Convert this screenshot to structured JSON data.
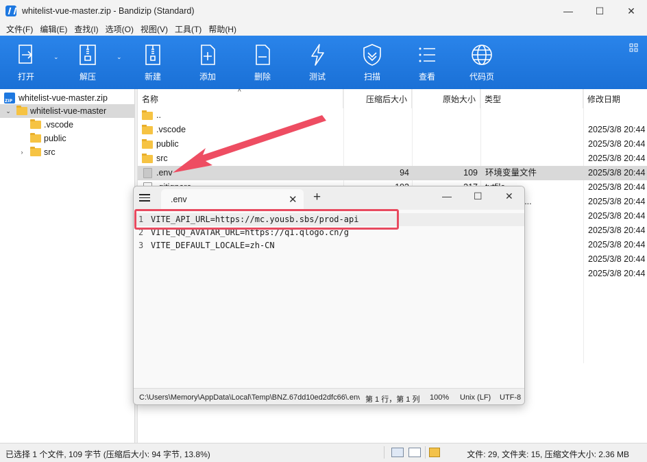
{
  "window": {
    "title": "whitelist-vue-master.zip - Bandizip (Standard)"
  },
  "menu": [
    "文件(F)",
    "编辑(E)",
    "查找(I)",
    "选项(O)",
    "视图(V)",
    "工具(T)",
    "帮助(H)"
  ],
  "toolbar": {
    "open": "打开",
    "extract": "解压",
    "new": "新建",
    "add": "添加",
    "delete": "删除",
    "test": "测试",
    "scan": "扫描",
    "view": "查看",
    "codepage": "代码页"
  },
  "tree": {
    "root": "whitelist-vue-master.zip",
    "folder": "whitelist-vue-master",
    "children": [
      ".vscode",
      "public",
      "src"
    ]
  },
  "columns": {
    "name": "名称",
    "compressed": "压缩后大小",
    "original": "原始大小",
    "type": "类型",
    "modified": "修改日期"
  },
  "rows": [
    {
      "name": "..",
      "compressed": "",
      "original": "",
      "type": "",
      "modified": ""
    },
    {
      "name": ".vscode",
      "compressed": "",
      "original": "",
      "type": "",
      "modified": "2025/3/8 20:44"
    },
    {
      "name": "public",
      "compressed": "",
      "original": "",
      "type": "",
      "modified": "2025/3/8 20:44"
    },
    {
      "name": "src",
      "compressed": "",
      "original": "",
      "type": "",
      "modified": "2025/3/8 20:44"
    },
    {
      "name": ".env",
      "compressed": "94",
      "original": "109",
      "type": "环境变量文件",
      "modified": "2025/3/8 20:44"
    },
    {
      "name": ".gitignore",
      "compressed": "193",
      "original": "317",
      "type": "txtfile",
      "modified": "2025/3/8 20:44"
    },
    {
      "name": "",
      "compressed": "",
      "original": "",
      "type": "TML Docu...",
      "modified": "2025/3/8 20:44"
    },
    {
      "name": "",
      "compressed": "",
      "original": "",
      "type": "",
      "modified": "2025/3/8 20:44"
    },
    {
      "name": "",
      "compressed": "",
      "original": "",
      "type": "",
      "modified": "2025/3/8 20:44"
    },
    {
      "name": "",
      "compressed": "",
      "original": "",
      "type": "",
      "modified": "2025/3/8 20:44"
    },
    {
      "name": "",
      "compressed": "",
      "original": "",
      "type": "n 文件",
      "modified": "2025/3/8 20:44"
    },
    {
      "name": "",
      "compressed": "",
      "original": "",
      "type": "文件",
      "modified": "2025/3/8 20:44"
    }
  ],
  "status": {
    "left": "已选择 1 个文件, 109 字节 (压缩后大小: 94 字节, 13.8%)",
    "right": "文件: 29, 文件夹: 15, 压缩文件大小: 2.36 MB"
  },
  "notepad": {
    "tab_title": ".env",
    "lines": [
      {
        "num": "1",
        "code": "VITE_API_URL=https://mc.yousb.sbs/prod-api"
      },
      {
        "num": "2",
        "code": "VITE_QQ_AVATAR_URL=https://q1.qlogo.cn/g"
      },
      {
        "num": "3",
        "code": "VITE_DEFAULT_LOCALE=zh-CN"
      }
    ],
    "status_path": "C:\\Users\\Memory\\AppData\\Local\\Temp\\BNZ.67dd10ed2dfc66\\.env",
    "status_pos": "第 1 行，第 1 列",
    "status_zoom": "100%",
    "status_eol": "Unix (LF)",
    "status_enc": "UTF-8"
  },
  "colors": {
    "toolbar": "#1f7ae0",
    "highlight": "#e84a5f",
    "folder": "#f6c343"
  }
}
